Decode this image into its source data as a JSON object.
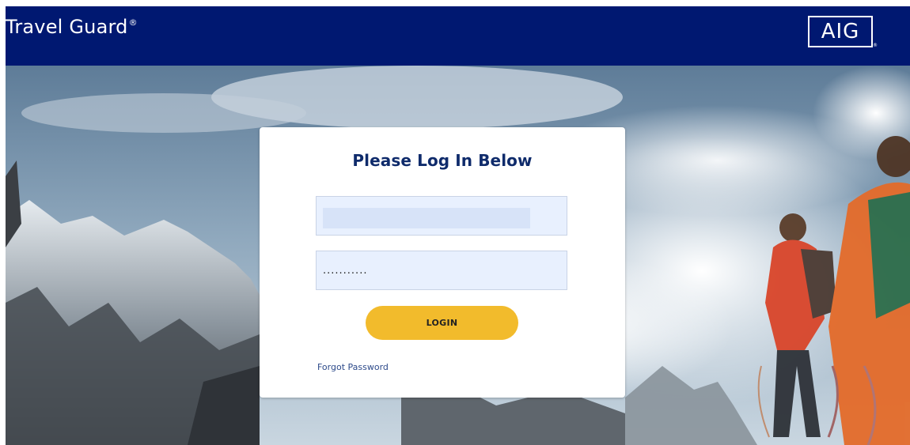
{
  "header": {
    "brand": "Travel Guard",
    "brand_mark": "®",
    "logo": "AIG",
    "logo_mark": "®"
  },
  "login": {
    "title": "Please Log In Below",
    "username_value": "",
    "password_value": "...........",
    "login_label": "LOGIN",
    "forgot_label": "Forgot Password"
  },
  "colors": {
    "header_bg": "#001871",
    "button": "#f2bb2c",
    "title": "#0f2b6b",
    "link": "#2d4a8a"
  }
}
